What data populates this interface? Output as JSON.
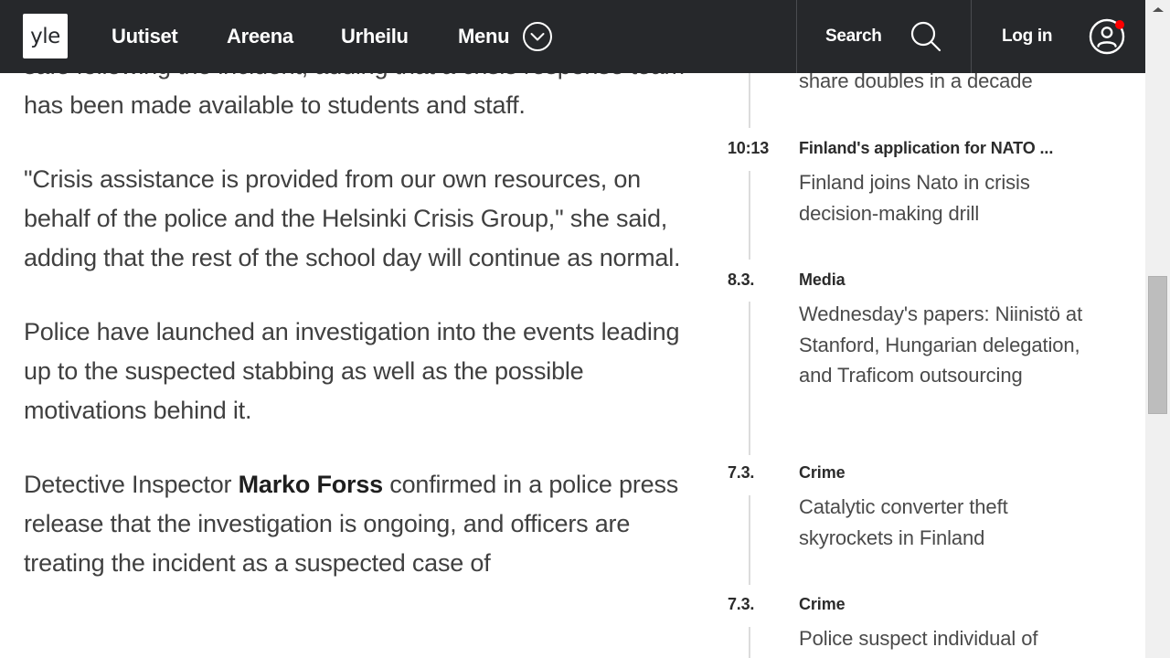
{
  "header": {
    "logo_text": "yle",
    "nav": [
      {
        "label": "Uutiset"
      },
      {
        "label": "Areena"
      },
      {
        "label": "Urheilu"
      }
    ],
    "menu_label": "Menu",
    "menu_icon": "chevron-down-circle-icon",
    "search_label": "Search",
    "search_icon": "search-icon",
    "login_label": "Log in",
    "login_icon": "user-circle-icon",
    "notification_dot_color": "#ff0000",
    "background_color": "#26282b"
  },
  "article": {
    "partial_top_line": "safe following the incident, adding that a crisis",
    "p1_rest": "response team has been made available to students and staff.",
    "p2": "\"Crisis assistance is provided from our own resources, on behalf of the police and the Helsinki Crisis Group,\" she said, adding that the rest of the school day will continue as normal.",
    "p3": "Police have launched an investigation into the events leading up to the suspected stabbing as well as the possible motivations behind it.",
    "p4_before": "Detective Inspector ",
    "p4_bold": "Marko Forss",
    "p4_after": " confirmed in a police press release that the investigation is ongoing, and officers are treating the incident as a suspected case of"
  },
  "feed": {
    "items": [
      {
        "time": "",
        "category": "",
        "title": "share doubles in a decade"
      },
      {
        "time": "10:13",
        "category": "Finland's application for NATO ...",
        "title": "Finland joins Nato in crisis decision-making drill"
      },
      {
        "time": "8.3.",
        "category": "Media",
        "title": "Wednesday's papers: Niinistö at Stanford, Hungarian delegation, and Traficom outsourcing"
      },
      {
        "time": "7.3.",
        "category": "Crime",
        "title": "Catalytic converter theft skyrockets in Finland"
      },
      {
        "time": "7.3.",
        "category": "Crime",
        "title": "Police suspect individual of"
      }
    ]
  },
  "scrollbar": {
    "scroll_position_fraction": 0.42,
    "visible_fraction": 0.21
  }
}
